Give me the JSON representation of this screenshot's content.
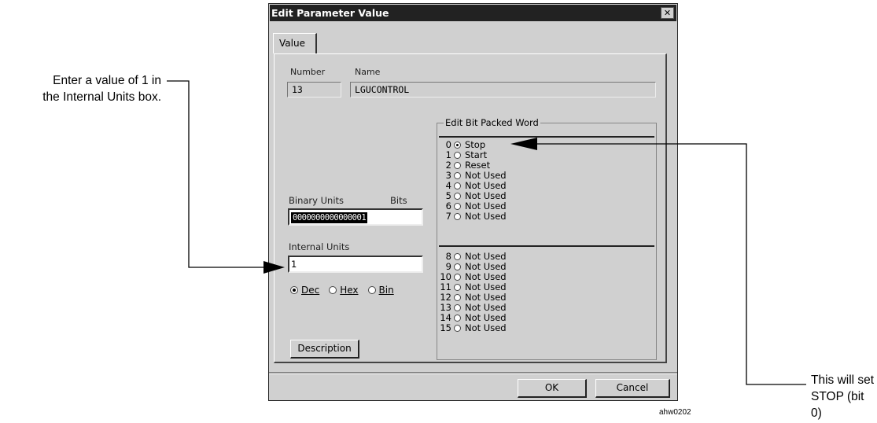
{
  "annotations": {
    "left_line1": "Enter a value of 1 in",
    "left_line2": "the Internal Units box.",
    "right_line1": "This will set",
    "right_line2": "STOP (bit 0)",
    "figure_id": "ahw0202"
  },
  "dialog": {
    "title": "Edit Parameter Value",
    "close_glyph": "✕",
    "tab_label": "Value",
    "number_label": "Number",
    "number_value": "13",
    "name_label": "Name",
    "name_value": "LGUCONTROL",
    "binary_units_label": "Binary Units",
    "bits_label": "Bits",
    "binary_value": "0000000000000001",
    "internal_units_label": "Internal Units",
    "internal_value": "1",
    "radix": [
      {
        "label": "Dec",
        "selected": true
      },
      {
        "label": "Hex",
        "selected": false
      },
      {
        "label": "Bin",
        "selected": false
      }
    ],
    "description_button": "Description",
    "group_title": "Edit Bit Packed Word",
    "bits": [
      {
        "n": "0",
        "label": "Stop",
        "selected": true
      },
      {
        "n": "1",
        "label": "Start",
        "selected": false
      },
      {
        "n": "2",
        "label": "Reset",
        "selected": false
      },
      {
        "n": "3",
        "label": "Not Used",
        "selected": false
      },
      {
        "n": "4",
        "label": "Not Used",
        "selected": false
      },
      {
        "n": "5",
        "label": "Not Used",
        "selected": false
      },
      {
        "n": "6",
        "label": "Not Used",
        "selected": false
      },
      {
        "n": "7",
        "label": "Not Used",
        "selected": false
      },
      {
        "n": "8",
        "label": "Not Used",
        "selected": false
      },
      {
        "n": "9",
        "label": "Not Used",
        "selected": false
      },
      {
        "n": "10",
        "label": "Not Used",
        "selected": false
      },
      {
        "n": "11",
        "label": "Not Used",
        "selected": false
      },
      {
        "n": "12",
        "label": "Not Used",
        "selected": false
      },
      {
        "n": "13",
        "label": "Not Used",
        "selected": false
      },
      {
        "n": "14",
        "label": "Not Used",
        "selected": false
      },
      {
        "n": "15",
        "label": "Not Used",
        "selected": false
      }
    ],
    "ok_button": "OK",
    "cancel_button": "Cancel"
  }
}
